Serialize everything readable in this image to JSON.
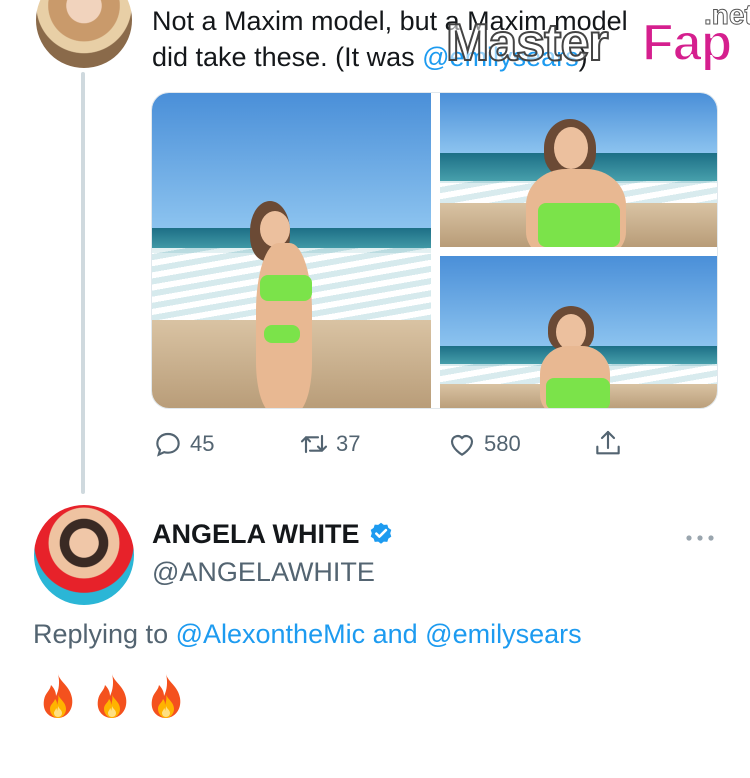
{
  "tweet": {
    "text_line1": "Not a Maxim model, but a Maxim model",
    "text_line2_prefix": "did take these. (It was ",
    "mention": "@emilysears",
    "text_line2_suffix": ")",
    "stats": {
      "replies": "45",
      "retweets": "37",
      "likes": "580"
    }
  },
  "watermark": {
    "master": "Master",
    "fap": "Fap",
    "net": ".net"
  },
  "reply": {
    "display_name": "ANGELA WHITE",
    "handle": "@ANGELAWHITE",
    "replying_prefix": "Replying to ",
    "replying_mention_1": "@AlexontheMic",
    "replying_and": " and ",
    "replying_mention_2": "@emilysears",
    "emojis": [
      "🔥",
      "🔥",
      "🔥"
    ]
  },
  "icons": {
    "reply": "reply-icon",
    "retweet": "retweet-icon",
    "like": "heart-icon",
    "share": "share-icon",
    "verified": "verified-badge-icon",
    "more": "more-options-icon"
  },
  "colors": {
    "accent": "#1d9bf0",
    "muted": "#536471",
    "text": "#14171a",
    "watermark_pink": "#d51f8e"
  }
}
